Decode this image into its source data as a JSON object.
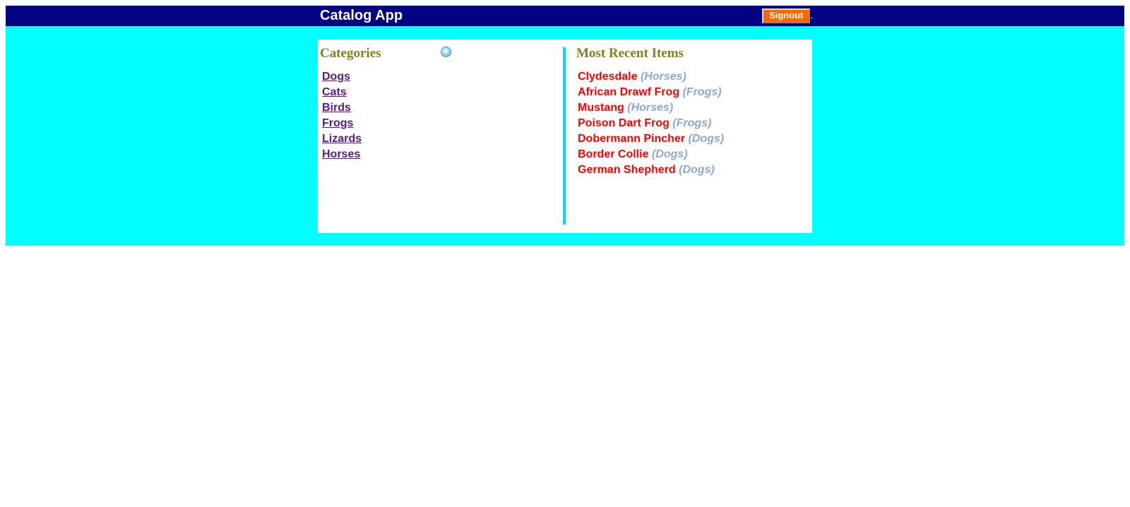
{
  "header": {
    "title": "Catalog App",
    "signout_label": "Signout",
    "signout_suffix": "."
  },
  "categories": {
    "title": "Categories",
    "add_icon": "add-circle-icon",
    "items": [
      {
        "label": "Dogs"
      },
      {
        "label": "Cats"
      },
      {
        "label": "Birds"
      },
      {
        "label": "Frogs"
      },
      {
        "label": "Lizards"
      },
      {
        "label": "Horses"
      }
    ]
  },
  "recent": {
    "title": "Most Recent Items",
    "items": [
      {
        "name": "Clydesdale",
        "category": "(Horses)"
      },
      {
        "name": "African Drawf Frog",
        "category": "(Frogs)"
      },
      {
        "name": "Mustang",
        "category": "(Horses)"
      },
      {
        "name": "Poison Dart Frog",
        "category": "(Frogs)"
      },
      {
        "name": "Dobermann Pincher",
        "category": "(Dogs)"
      },
      {
        "name": "Border Collie",
        "category": "(Dogs)"
      },
      {
        "name": "German Shepherd",
        "category": "(Dogs)"
      }
    ]
  },
  "colors": {
    "header_bg": "#000080",
    "content_bg": "#00ffff",
    "signout_bg": "#ff6600",
    "section_title": "#808020",
    "category_link": "#551a8b",
    "item_name": "#ff0000",
    "item_category": "#8fa8d0"
  }
}
